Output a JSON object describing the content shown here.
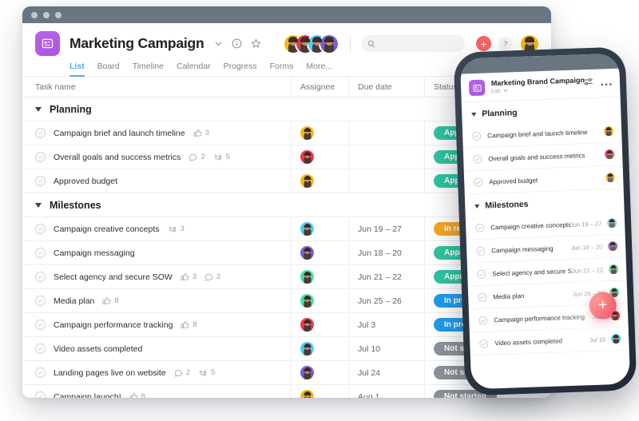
{
  "window": {
    "titlebar_dots": 3
  },
  "header": {
    "project_icon": "list-project-icon",
    "title": "Marketing Campaign",
    "chevron_icon": "chevron-down-icon",
    "info_icon": "info-circle-icon",
    "star_icon": "star-icon",
    "member_avatars": [
      {
        "name": "avatar-member-1",
        "bg": "#F5B914"
      },
      {
        "name": "avatar-member-2",
        "bg": "#E8384F"
      },
      {
        "name": "avatar-member-3",
        "bg": "#4ECBF4"
      },
      {
        "name": "avatar-member-4",
        "bg": "#7B5CD6"
      }
    ],
    "search": {
      "icon": "search-icon",
      "value": "",
      "placeholder": ""
    },
    "add_label": "+",
    "help_label": "?",
    "me_avatar": {
      "name": "avatar-current-user",
      "bg": "#F5B914"
    }
  },
  "tabs": [
    {
      "label": "List",
      "active": true
    },
    {
      "label": "Board",
      "active": false
    },
    {
      "label": "Timeline",
      "active": false
    },
    {
      "label": "Calendar",
      "active": false
    },
    {
      "label": "Progress",
      "active": false
    },
    {
      "label": "Forms",
      "active": false
    },
    {
      "label": "More...",
      "active": false
    }
  ],
  "columns": {
    "task": "Task name",
    "assignee": "Assignee",
    "due": "Due date",
    "status": "Status"
  },
  "colors": {
    "accent_blue": "#4BAFE8",
    "titlebar": "#697682",
    "status_approved": "#2EC4A0",
    "status_in_review": "#F5A623",
    "status_in_progress": "#1E9CEB",
    "status_not_started": "#8A9199",
    "project_purple": "#A855E0",
    "add_red": "#FA6363"
  },
  "sections": [
    {
      "name": "Planning",
      "tasks": [
        {
          "name": "Campaign brief and launch timeline",
          "meta": [
            {
              "icon": "thumbs-up-icon",
              "count": "3"
            }
          ],
          "assignee": {
            "name": "avatar-assignee",
            "bg": "#F5B914"
          },
          "due": "",
          "status": {
            "label": "Approved",
            "color": "#2EC4A0"
          }
        },
        {
          "name": "Overall goals and success metrics",
          "meta": [
            {
              "icon": "comment-icon",
              "count": "2"
            },
            {
              "icon": "subtask-icon",
              "count": "5"
            }
          ],
          "assignee": {
            "name": "avatar-assignee",
            "bg": "#E8384F"
          },
          "due": "",
          "status": {
            "label": "Approved",
            "color": "#2EC4A0"
          }
        },
        {
          "name": "Approved budget",
          "meta": [],
          "assignee": {
            "name": "avatar-assignee",
            "bg": "#F5B914"
          },
          "due": "",
          "status": {
            "label": "Approved",
            "color": "#2EC4A0"
          }
        }
      ]
    },
    {
      "name": "Milestones",
      "tasks": [
        {
          "name": "Campaign creative concepts",
          "meta": [
            {
              "icon": "subtask-icon",
              "count": "3"
            }
          ],
          "assignee": {
            "name": "avatar-assignee",
            "bg": "#4ECBF4"
          },
          "due": "Jun 19 – 27",
          "status": {
            "label": "In review",
            "color": "#F5A623"
          }
        },
        {
          "name": "Campaign messaging",
          "meta": [],
          "assignee": {
            "name": "avatar-assignee",
            "bg": "#7B5CD6"
          },
          "due": "Jun 18 – 20",
          "status": {
            "label": "Approved",
            "color": "#2EC4A0"
          }
        },
        {
          "name": "Select agency and secure SOW",
          "meta": [
            {
              "icon": "thumbs-up-icon",
              "count": "3"
            },
            {
              "icon": "comment-icon",
              "count": "2"
            }
          ],
          "assignee": {
            "name": "avatar-assignee",
            "bg": "#4ADFA0"
          },
          "due": "Jun 21 – 22",
          "status": {
            "label": "Approved",
            "color": "#2EC4A0"
          }
        },
        {
          "name": "Media plan",
          "meta": [
            {
              "icon": "thumbs-up-icon",
              "count": "8"
            }
          ],
          "assignee": {
            "name": "avatar-assignee",
            "bg": "#4ADFA0"
          },
          "due": "Jun 25 – 26",
          "status": {
            "label": "In progress",
            "color": "#1E9CEB"
          }
        },
        {
          "name": "Campaign performance tracking",
          "meta": [
            {
              "icon": "thumbs-up-icon",
              "count": "8"
            }
          ],
          "assignee": {
            "name": "avatar-assignee",
            "bg": "#E8384F"
          },
          "due": "Jul 3",
          "status": {
            "label": "In progress",
            "color": "#1E9CEB"
          }
        },
        {
          "name": "Video assets completed",
          "meta": [],
          "assignee": {
            "name": "avatar-assignee",
            "bg": "#4ECBF4"
          },
          "due": "Jul 10",
          "status": {
            "label": "Not started",
            "color": "#8A9199"
          }
        },
        {
          "name": "Landing pages live on website",
          "meta": [
            {
              "icon": "comment-icon",
              "count": "2"
            },
            {
              "icon": "subtask-icon",
              "count": "5"
            }
          ],
          "assignee": {
            "name": "avatar-assignee",
            "bg": "#7B5CD6"
          },
          "due": "Jul 24",
          "status": {
            "label": "Not started",
            "color": "#8A9199"
          }
        },
        {
          "name": "Campaign launch!",
          "meta": [
            {
              "icon": "thumbs-up-icon",
              "count": "8"
            }
          ],
          "assignee": {
            "name": "avatar-assignee",
            "bg": "#F5B914"
          },
          "due": "Aug 1",
          "status": {
            "label": "Not started",
            "color": "#8A9199"
          }
        }
      ]
    }
  ],
  "phone": {
    "project_icon": "list-project-icon",
    "title": "Marketing Brand Campaign",
    "view_label": "List",
    "view_chevron": "chevron-down-icon",
    "filter_icon": "filter-sliders-icon",
    "overflow_icon": "more-horizontal-icon",
    "fab_label": "+",
    "sections": [
      {
        "name": "Planning",
        "tasks": [
          {
            "name": "Campaign brief and launch timeline",
            "due": "",
            "assignee": {
              "name": "avatar-assignee",
              "bg": "#F5B914"
            }
          },
          {
            "name": "Overall goals and success metrics",
            "due": "",
            "assignee": {
              "name": "avatar-assignee",
              "bg": "#E8384F"
            }
          },
          {
            "name": "Approved budget",
            "due": "",
            "assignee": {
              "name": "avatar-assignee",
              "bg": "#F5B914"
            }
          }
        ]
      },
      {
        "name": "Milestones",
        "tasks": [
          {
            "name": "Campaign creative concepts",
            "due": "Jun 19 – 27",
            "assignee": {
              "name": "avatar-assignee",
              "bg": "#4ECBF4"
            }
          },
          {
            "name": "Campaign messaging",
            "due": "Jun 18 – 20",
            "assignee": {
              "name": "avatar-assignee",
              "bg": "#7B5CD6"
            }
          },
          {
            "name": "Select agency and secure SOW",
            "due": "Jun 21 – 22",
            "assignee": {
              "name": "avatar-assignee",
              "bg": "#4ADFA0"
            }
          },
          {
            "name": "Media plan",
            "due": "Jun 25 – 26",
            "assignee": {
              "name": "avatar-assignee",
              "bg": "#4ADFA0"
            }
          },
          {
            "name": "Campaign performance tracking",
            "due": "Jul 3",
            "assignee": {
              "name": "avatar-assignee",
              "bg": "#E8384F"
            }
          },
          {
            "name": "Video assets completed",
            "due": "Jul 10",
            "assignee": {
              "name": "avatar-assignee",
              "bg": "#4ECBF4"
            }
          }
        ]
      }
    ]
  }
}
